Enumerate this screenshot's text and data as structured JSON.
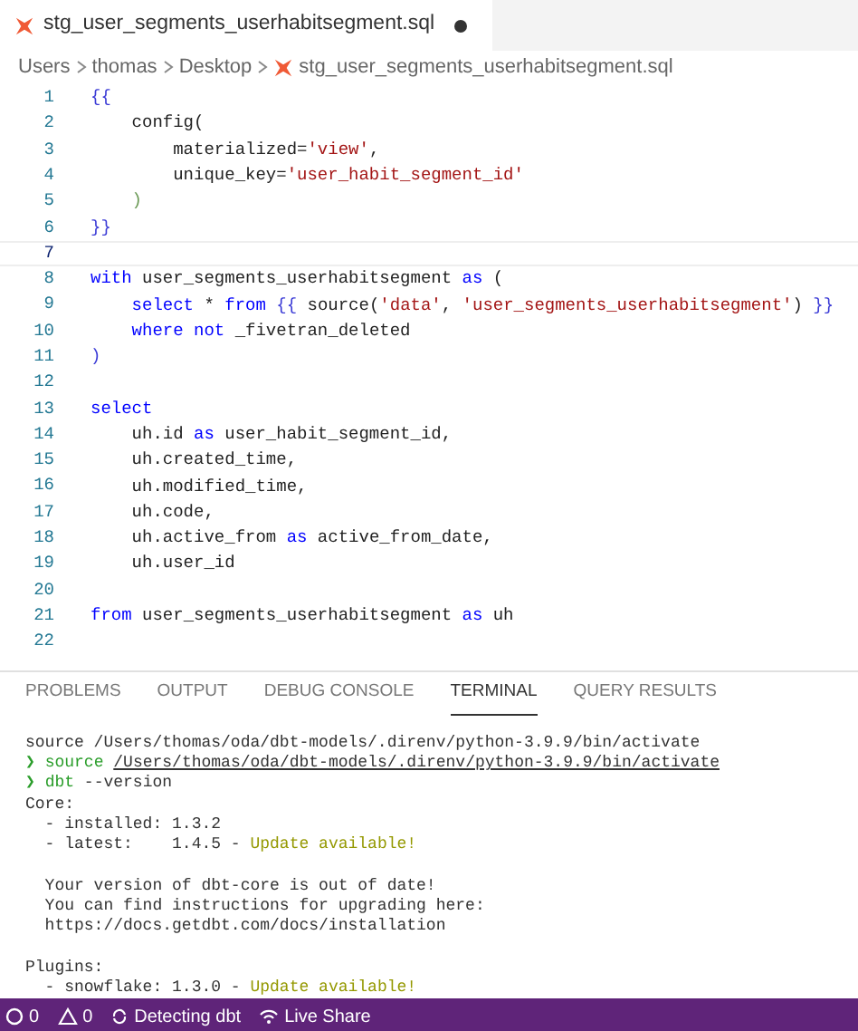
{
  "tab": {
    "title": "stg_user_segments_userhabitsegment.sql",
    "modified": true
  },
  "breadcrumb": [
    {
      "text": "Users",
      "kind": "folder"
    },
    {
      "text": "thomas",
      "kind": "folder"
    },
    {
      "text": "Desktop",
      "kind": "folder"
    },
    {
      "text": "stg_user_segments_userhabitsegment.sql",
      "kind": "file"
    }
  ],
  "code": [
    {
      "number": "1",
      "current": false,
      "tokens": [
        {
          "text": "{{",
          "kind": "brace"
        }
      ]
    },
    {
      "number": "2",
      "current": false,
      "tokens": [
        {
          "text": "    config(",
          "kind": "text"
        }
      ]
    },
    {
      "number": "3",
      "current": false,
      "tokens": [
        {
          "text": "        materialized=",
          "kind": "text"
        },
        {
          "text": "'view'",
          "kind": "str"
        },
        {
          "text": ",",
          "kind": "text"
        }
      ]
    },
    {
      "number": "4",
      "current": false,
      "tokens": [
        {
          "text": "        unique_key=",
          "kind": "text"
        },
        {
          "text": "'user_habit_segment_id'",
          "kind": "str"
        }
      ]
    },
    {
      "number": "5",
      "current": false,
      "tokens": [
        {
          "text": "    )",
          "kind": "paren"
        }
      ]
    },
    {
      "number": "6",
      "current": false,
      "tokens": [
        {
          "text": "}}",
          "kind": "brace"
        }
      ]
    },
    {
      "number": "7",
      "current": true
    },
    {
      "number": "8",
      "current": false,
      "tokens": [
        {
          "text": "with",
          "kind": "kw"
        },
        {
          "text": " user_segments_userhabitsegment ",
          "kind": "text"
        },
        {
          "text": "as",
          "kind": "kw"
        },
        {
          "text": " (",
          "kind": "text"
        }
      ]
    },
    {
      "number": "9",
      "current": false,
      "tokens": [
        {
          "text": "    select",
          "kind": "kw"
        },
        {
          "text": " * ",
          "kind": "text"
        },
        {
          "text": "from",
          "kind": "kw"
        },
        {
          "text": " {{ ",
          "kind": "brace"
        },
        {
          "text": "source(",
          "kind": "text"
        },
        {
          "text": "'data'",
          "kind": "str"
        },
        {
          "text": ", ",
          "kind": "text"
        },
        {
          "text": "'user_segments_userhabitsegment'",
          "kind": "str"
        },
        {
          "text": ") ",
          "kind": "text"
        },
        {
          "text": "}}",
          "kind": "brace"
        }
      ]
    },
    {
      "number": "10",
      "current": false,
      "tokens": [
        {
          "text": "    where not",
          "kind": "kw"
        },
        {
          "text": " _fivetran_deleted",
          "kind": "text"
        }
      ]
    },
    {
      "number": "11",
      "current": false,
      "tokens": [
        {
          "text": ")",
          "kind": "brace"
        }
      ]
    },
    {
      "number": "12",
      "current": false
    },
    {
      "number": "13",
      "current": false,
      "tokens": [
        {
          "text": "select",
          "kind": "kw"
        }
      ]
    },
    {
      "number": "14",
      "current": false,
      "tokens": [
        {
          "text": "    uh.id ",
          "kind": "text"
        },
        {
          "text": "as",
          "kind": "kw"
        },
        {
          "text": " user_habit_segment_id,",
          "kind": "text"
        }
      ]
    },
    {
      "number": "15",
      "current": false,
      "tokens": [
        {
          "text": "    uh.created_time,",
          "kind": "text"
        }
      ]
    },
    {
      "number": "16",
      "current": false,
      "tokens": [
        {
          "text": "    uh.modified_time,",
          "kind": "text"
        }
      ]
    },
    {
      "number": "17",
      "current": false,
      "tokens": [
        {
          "text": "    uh.code,",
          "kind": "text"
        }
      ]
    },
    {
      "number": "18",
      "current": false,
      "tokens": [
        {
          "text": "    uh.active_from ",
          "kind": "text"
        },
        {
          "text": "as",
          "kind": "kw"
        },
        {
          "text": " active_from_date,",
          "kind": "text"
        }
      ]
    },
    {
      "number": "19",
      "current": false,
      "tokens": [
        {
          "text": "    uh.user_id",
          "kind": "text"
        }
      ]
    },
    {
      "number": "20",
      "current": false
    },
    {
      "number": "21",
      "current": false,
      "tokens": [
        {
          "text": "from",
          "kind": "kw"
        },
        {
          "text": " user_segments_userhabitsegment ",
          "kind": "text"
        },
        {
          "text": "as",
          "kind": "kw"
        },
        {
          "text": " uh",
          "kind": "text"
        }
      ]
    },
    {
      "number": "22",
      "current": false
    }
  ],
  "panel_tabs": [
    {
      "label": "PROBLEMS",
      "selected": false
    },
    {
      "label": "OUTPUT",
      "selected": false
    },
    {
      "label": "DEBUG CONSOLE",
      "selected": false
    },
    {
      "label": "TERMINAL",
      "selected": true
    },
    {
      "label": "QUERY RESULTS",
      "selected": false
    }
  ],
  "terminal": [
    {
      "kind": "line",
      "segments": [
        {
          "text": "source /Users/thomas/oda/dbt-models/.direnv/python-3.9.9/bin/activate",
          "kind": "text"
        }
      ]
    },
    {
      "kind": "line",
      "segments": [
        {
          "text": "❯ source ",
          "kind": "cmd"
        },
        {
          "text": "/Users/thomas/oda/dbt-models/.direnv/python-3.9.9/bin/activate",
          "kind": "path"
        }
      ]
    },
    {
      "kind": "line",
      "segments": [
        {
          "text": "❯ dbt",
          "kind": "cmd"
        },
        {
          "text": " --version",
          "kind": "text"
        }
      ]
    },
    {
      "kind": "line",
      "segments": [
        {
          "text": "Core:",
          "kind": "text"
        }
      ]
    },
    {
      "kind": "line",
      "segments": [
        {
          "text": "  - installed: 1.3.2",
          "kind": "text"
        }
      ]
    },
    {
      "kind": "line",
      "segments": [
        {
          "text": "  - latest:    1.4.5 - ",
          "kind": "text"
        },
        {
          "text": "Update available!",
          "kind": "warn"
        }
      ]
    },
    {
      "kind": "blank"
    },
    {
      "kind": "line",
      "segments": [
        {
          "text": "  Your version of dbt-core is out of date!",
          "kind": "text"
        }
      ]
    },
    {
      "kind": "line",
      "segments": [
        {
          "text": "  You can find instructions for upgrading here:",
          "kind": "text"
        }
      ]
    },
    {
      "kind": "line",
      "segments": [
        {
          "text": "  https://docs.getdbt.com/docs/installation",
          "kind": "text"
        }
      ]
    },
    {
      "kind": "blank"
    },
    {
      "kind": "line",
      "segments": [
        {
          "text": "Plugins:",
          "kind": "text"
        }
      ]
    },
    {
      "kind": "line",
      "segments": [
        {
          "text": "  - snowflake: 1.3.0 - ",
          "kind": "text"
        },
        {
          "text": "Update available!",
          "kind": "warn"
        }
      ]
    }
  ],
  "status_bar": [
    {
      "kind": "errors",
      "text": "0"
    },
    {
      "kind": "warnings",
      "text": "0"
    },
    {
      "kind": "sync",
      "text": "Detecting dbt"
    },
    {
      "kind": "share",
      "text": "Live Share"
    }
  ]
}
